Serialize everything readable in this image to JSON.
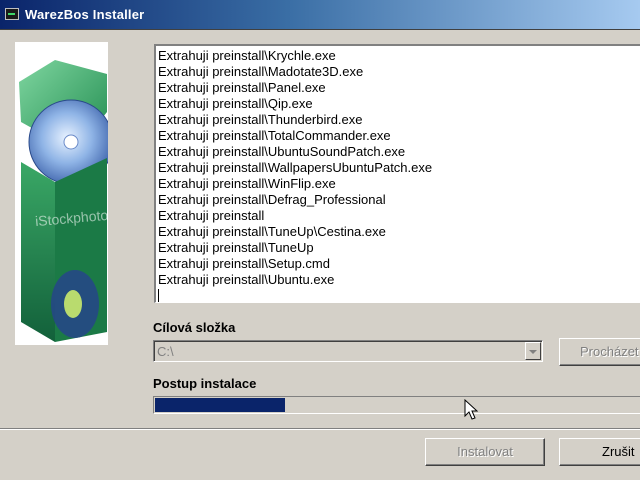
{
  "window": {
    "title": "WarezBos Installer",
    "icon": "console-app-icon"
  },
  "side_image": {
    "watermark": "iStockphoto",
    "icon": "cd-box-graphic"
  },
  "log": {
    "lines": [
      "Extrahuji preinstall\\Krychle.exe",
      "Extrahuji preinstall\\Madotate3D.exe",
      "Extrahuji preinstall\\Panel.exe",
      "Extrahuji preinstall\\Qip.exe",
      "Extrahuji preinstall\\Thunderbird.exe",
      "Extrahuji preinstall\\TotalCommander.exe",
      "Extrahuji preinstall\\UbuntuSoundPatch.exe",
      "Extrahuji preinstall\\WallpapersUbuntuPatch.exe",
      "Extrahuji preinstall\\WinFlip.exe",
      "Extrahuji preinstall\\Defrag_Professional",
      "Extrahuji preinstall",
      "Extrahuji preinstall\\TuneUp\\Cestina.exe",
      "Extrahuji preinstall\\TuneUp",
      "Extrahuji preinstall\\Setup.cmd",
      "Extrahuji preinstall\\Ubuntu.exe"
    ]
  },
  "target": {
    "label": "Cílová složka",
    "value": "C:\\",
    "browse_label": "Procházet"
  },
  "progress": {
    "label": "Postup instalace",
    "fraction": 0.27,
    "color": "#0a246a"
  },
  "buttons": {
    "install_label": "Instalovat",
    "cancel_label": "Zrušit"
  }
}
